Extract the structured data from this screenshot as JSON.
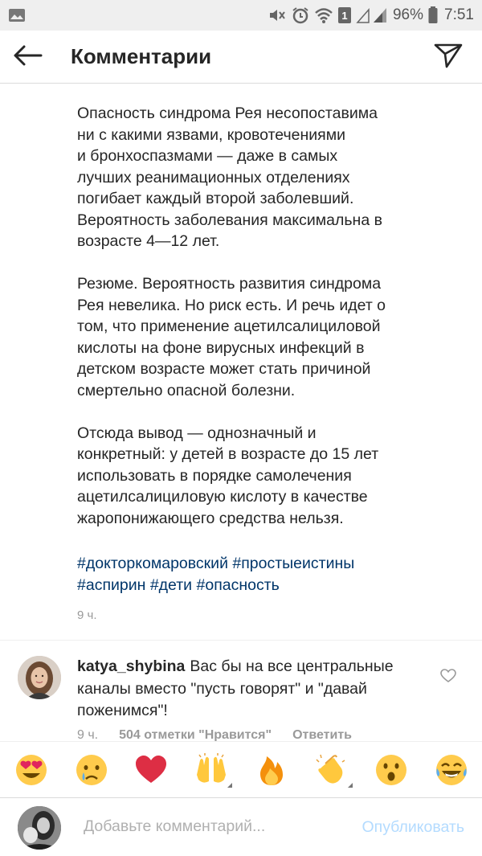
{
  "status_bar": {
    "notification_count": "1",
    "battery": "96%",
    "time": "7:51",
    "icons": [
      "gallery-icon",
      "mute-icon",
      "alarm-icon",
      "wifi-icon",
      "sim-icon",
      "signal-icon",
      "battery-icon"
    ]
  },
  "header": {
    "title": "Комментарии",
    "back_icon": "arrow-left-icon",
    "send_icon": "direct-send-icon"
  },
  "post": {
    "paragraphs": [
      "Опасность синдрома Рея несопоставима\nни с какими язвами, кровотечениями\nи бронхоспазмами — даже в самых\nлучших реанимационных отделениях\nпогибает каждый второй заболевший.\nВероятность заболевания максимальна в\nвозрасте 4—12 лет.",
      "Резюме. Вероятность развития синдрома\nРея невелика. Но риск есть. И речь идет о\nтом, что применение ацетилсалициловой\nкислоты на фоне вирусных инфекций в\nдетском возрасте может стать причиной\nсмертельно опасной болезни.",
      "Отсюда вывод — однозначный и\nконкретный: у детей в возрасте до 15 лет\nиспользовать в порядке самолечения\nацетилсалициловую кислоту в качестве\nжаропонижающего средства нельзя."
    ],
    "hashtags": [
      "#докторкомаровский",
      "#простыеистины",
      "#аспирин",
      "#дети",
      "#опасность"
    ],
    "time": "9 ч."
  },
  "comment": {
    "username": "katya_shybina",
    "text": "Вас бы на все центральные каналы вместо \"пусть говорят\" и \"давай поженимся\"!",
    "time": "9 ч.",
    "likes": "504 отметки \"Нравится\"",
    "reply": "Ответить"
  },
  "emoji_bar": [
    {
      "name": "heart-eyes-emoji",
      "glyph": "😍"
    },
    {
      "name": "crying-emoji",
      "glyph": "😢"
    },
    {
      "name": "red-heart-emoji",
      "glyph": "❤️"
    },
    {
      "name": "raising-hands-emoji",
      "glyph": "🙌"
    },
    {
      "name": "fire-emoji",
      "glyph": "🔥"
    },
    {
      "name": "clapping-hands-emoji",
      "glyph": "👏"
    },
    {
      "name": "surprised-emoji",
      "glyph": "😮"
    },
    {
      "name": "laughing-tears-emoji",
      "glyph": "😂"
    }
  ],
  "input": {
    "placeholder": "Добавьте комментарий...",
    "value": "",
    "publish_label": "Опубликовать"
  },
  "colors": {
    "text": "#262626",
    "secondary": "#999999",
    "hashtag": "#003569",
    "publish_disabled": "#b3dbff",
    "divider": "#dbdbdb"
  }
}
